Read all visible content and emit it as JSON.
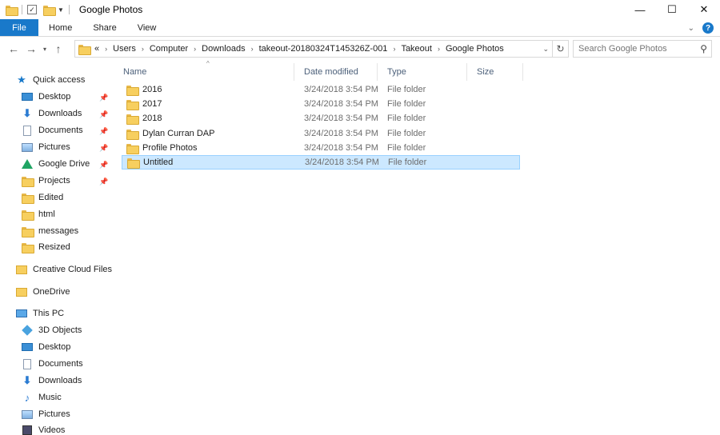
{
  "window": {
    "title": "Google Photos",
    "controls": {
      "minimize": "—",
      "maximize": "☐",
      "close": "✕"
    }
  },
  "ribbon": {
    "tabs": [
      "File",
      "Home",
      "Share",
      "View"
    ],
    "help": "?",
    "expand": "⌄"
  },
  "address": {
    "overflow": "«",
    "crumbs": [
      "Users",
      "Computer",
      "Downloads",
      "takeout-20180324T145326Z-001",
      "Takeout",
      "Google Photos"
    ]
  },
  "search": {
    "placeholder": "Search Google Photos"
  },
  "columns": {
    "name": "Name",
    "date": "Date modified",
    "type": "Type",
    "size": "Size"
  },
  "files": [
    {
      "name": "2016",
      "date": "3/24/2018 3:54 PM",
      "type": "File folder",
      "selected": false
    },
    {
      "name": "2017",
      "date": "3/24/2018 3:54 PM",
      "type": "File folder",
      "selected": false
    },
    {
      "name": "2018",
      "date": "3/24/2018 3:54 PM",
      "type": "File folder",
      "selected": false
    },
    {
      "name": "Dylan Curran DAP",
      "date": "3/24/2018 3:54 PM",
      "type": "File folder",
      "selected": false
    },
    {
      "name": "Profile Photos",
      "date": "3/24/2018 3:54 PM",
      "type": "File folder",
      "selected": false
    },
    {
      "name": "Untitled",
      "date": "3/24/2018 3:54 PM",
      "type": "File folder",
      "selected": true
    }
  ],
  "nav": {
    "quick_access": "Quick access",
    "qa_items": [
      {
        "label": "Desktop",
        "icon": "desktop-icon",
        "pinned": true
      },
      {
        "label": "Downloads",
        "icon": "download-icon",
        "pinned": true
      },
      {
        "label": "Documents",
        "icon": "document-icon",
        "pinned": true
      },
      {
        "label": "Pictures",
        "icon": "pictures-icon",
        "pinned": true
      },
      {
        "label": "Google Drive",
        "icon": "google-drive-icon",
        "pinned": true
      },
      {
        "label": "Projects",
        "icon": "folder-icon",
        "pinned": true
      },
      {
        "label": "Edited",
        "icon": "folder-icon",
        "pinned": false
      },
      {
        "label": "html",
        "icon": "folder-icon",
        "pinned": false
      },
      {
        "label": "messages",
        "icon": "folder-icon",
        "pinned": false
      },
      {
        "label": "Resized",
        "icon": "folder-icon",
        "pinned": false
      }
    ],
    "creative_cloud": "Creative Cloud Files",
    "onedrive": "OneDrive",
    "this_pc": "This PC",
    "pc_items": [
      {
        "label": "3D Objects",
        "icon": "3d-objects-icon"
      },
      {
        "label": "Desktop",
        "icon": "desktop-icon"
      },
      {
        "label": "Documents",
        "icon": "document-icon"
      },
      {
        "label": "Downloads",
        "icon": "download-icon"
      },
      {
        "label": "Music",
        "icon": "music-icon"
      },
      {
        "label": "Pictures",
        "icon": "pictures-icon"
      },
      {
        "label": "Videos",
        "icon": "videos-icon"
      }
    ]
  }
}
